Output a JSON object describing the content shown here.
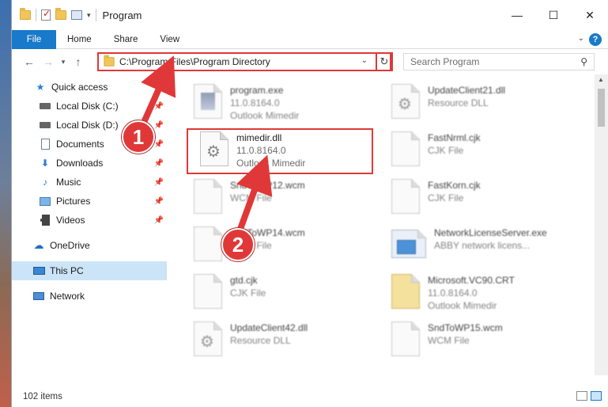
{
  "window": {
    "title": "Program",
    "controls": {
      "minimize": "—",
      "maximize": "☐",
      "close": "✕"
    }
  },
  "ribbon": {
    "tabs": [
      "File",
      "Home",
      "Share",
      "View"
    ]
  },
  "navbar": {
    "address": "C:\\Program Files\\Program Directory",
    "search_placeholder": "Search Program"
  },
  "sidebar": {
    "items": [
      {
        "label": "Quick access",
        "icon": "star-icon",
        "pinned": false
      },
      {
        "label": "Local Disk (C:)",
        "icon": "drive-icon",
        "pinned": true
      },
      {
        "label": "Local Disk (D:)",
        "icon": "drive-icon",
        "pinned": true
      },
      {
        "label": "Documents",
        "icon": "documents-icon",
        "pinned": true
      },
      {
        "label": "Downloads",
        "icon": "download-icon",
        "pinned": true
      },
      {
        "label": "Music",
        "icon": "music-icon",
        "pinned": true
      },
      {
        "label": "Pictures",
        "icon": "pictures-icon",
        "pinned": true
      },
      {
        "label": "Videos",
        "icon": "videos-icon",
        "pinned": true
      },
      {
        "label": "OneDrive",
        "icon": "cloud-icon",
        "pinned": false
      },
      {
        "label": "This PC",
        "icon": "computer-icon",
        "pinned": false
      },
      {
        "label": "Network",
        "icon": "network-icon",
        "pinned": false
      }
    ]
  },
  "files": [
    {
      "name": "program.exe",
      "line2": "11.0.8164.0",
      "line3": "Outlook Mimedir",
      "icon": "program-icon"
    },
    {
      "name": "UpdateClient21.dll",
      "line2": "Resource DLL",
      "line3": "",
      "icon": "dll-icon"
    },
    {
      "name": "mimedir.dll",
      "line2": "11.0.8164.0",
      "line3": "Outlook Mimedir",
      "icon": "dll-icon"
    },
    {
      "name": "FastNrml.cjk",
      "line2": "CJK File",
      "line3": "",
      "icon": "file-icon"
    },
    {
      "name": "SndToWP12.wcm",
      "line2": "WCM File",
      "line3": "",
      "icon": "file-icon"
    },
    {
      "name": "FastKorn.cjk",
      "line2": "CJK File",
      "line3": "",
      "icon": "file-icon"
    },
    {
      "name": "SndToWP14.wcm",
      "line2": "WCM File",
      "line3": "",
      "icon": "file-icon"
    },
    {
      "name": "NetworkLicenseServer.exe",
      "line2": "ABBY network licens...",
      "line3": "",
      "icon": "exe-icon"
    },
    {
      "name": "gtd.cjk",
      "line2": "CJK File",
      "line3": "",
      "icon": "file-icon"
    },
    {
      "name": "Microsoft.VC90.CRT",
      "line2": "11.0.8164.0",
      "line3": "Outlook Mimedir",
      "icon": "archive-icon"
    },
    {
      "name": "UpdateClient42.dll",
      "line2": "Resource DLL",
      "line3": "",
      "icon": "dll-icon"
    },
    {
      "name": "SndToWP15.wcm",
      "line2": "WCM File",
      "line3": "",
      "icon": "file-icon"
    }
  ],
  "status": {
    "item_count": "102 items"
  },
  "annotations": {
    "step1": "1",
    "step2": "2"
  },
  "colors": {
    "accent": "#1979ca",
    "highlight": "#e03838",
    "selected": "#cce4f7"
  }
}
